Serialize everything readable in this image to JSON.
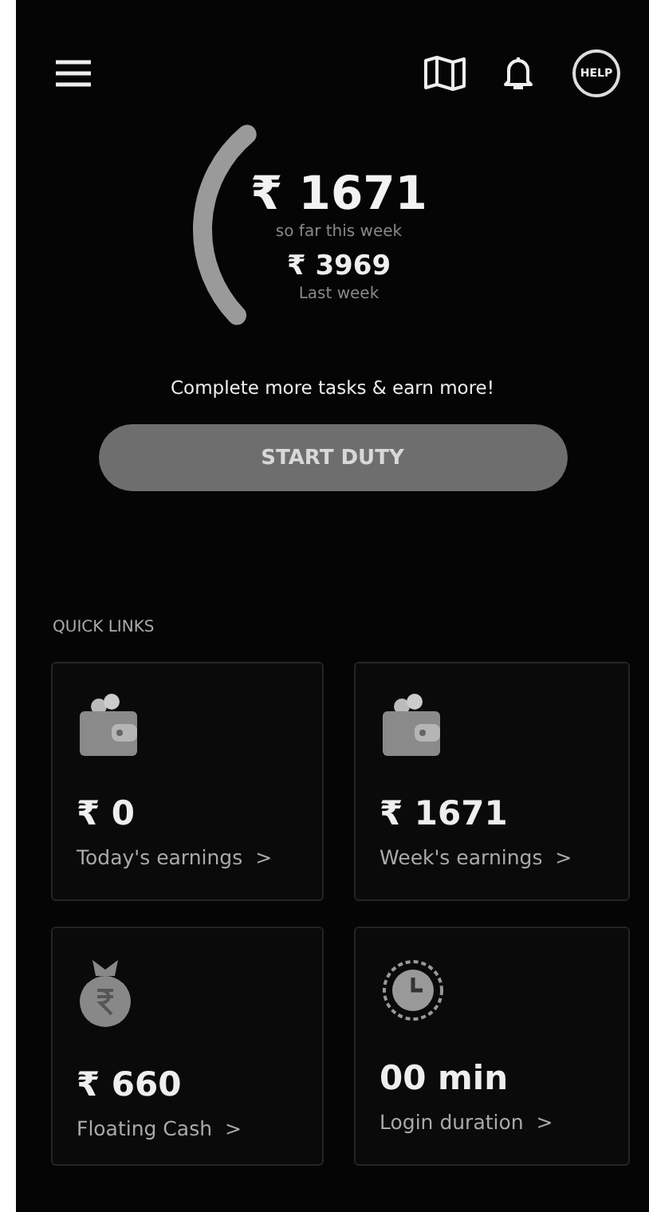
{
  "header": {
    "help_label": "HELP"
  },
  "summary": {
    "amount": "₹ 1671",
    "caption": "so far this week",
    "previous_amount": "₹ 3969",
    "previous_caption": "Last week"
  },
  "prompt": "Complete more tasks & earn more!",
  "start_button": "START DUTY",
  "quick_links": {
    "title": "QUICK LINKS",
    "cards": [
      {
        "kind": "wallet",
        "value": "₹ 0",
        "label": "Today's earnings",
        "arrow": ">"
      },
      {
        "kind": "wallet",
        "value": "₹ 1671",
        "label": "Week's earnings",
        "arrow": ">"
      },
      {
        "kind": "bag",
        "value": "₹ 660",
        "label": "Floating Cash",
        "arrow": ">"
      },
      {
        "kind": "clock",
        "value": "00 min",
        "label": "Login duration",
        "arrow": ">"
      }
    ]
  }
}
